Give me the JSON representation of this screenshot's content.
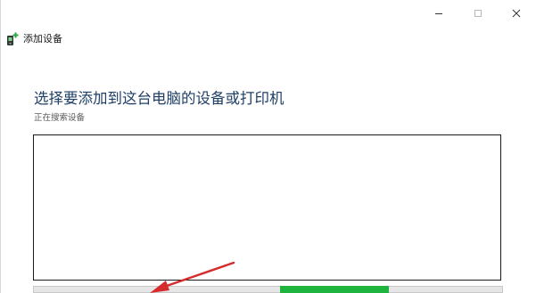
{
  "window": {
    "title": "添加设备"
  },
  "icons": {
    "app": "add-device-icon",
    "minimize": "minimize-icon",
    "maximize": "maximize-icon",
    "close": "close-icon"
  },
  "main": {
    "heading": "选择要添加到这台电脑的设备或打印机",
    "status": "正在搜索设备"
  },
  "colors": {
    "heading": "#1f3f66",
    "progress": "#1fb43e",
    "annotation": "#d62b2b"
  }
}
